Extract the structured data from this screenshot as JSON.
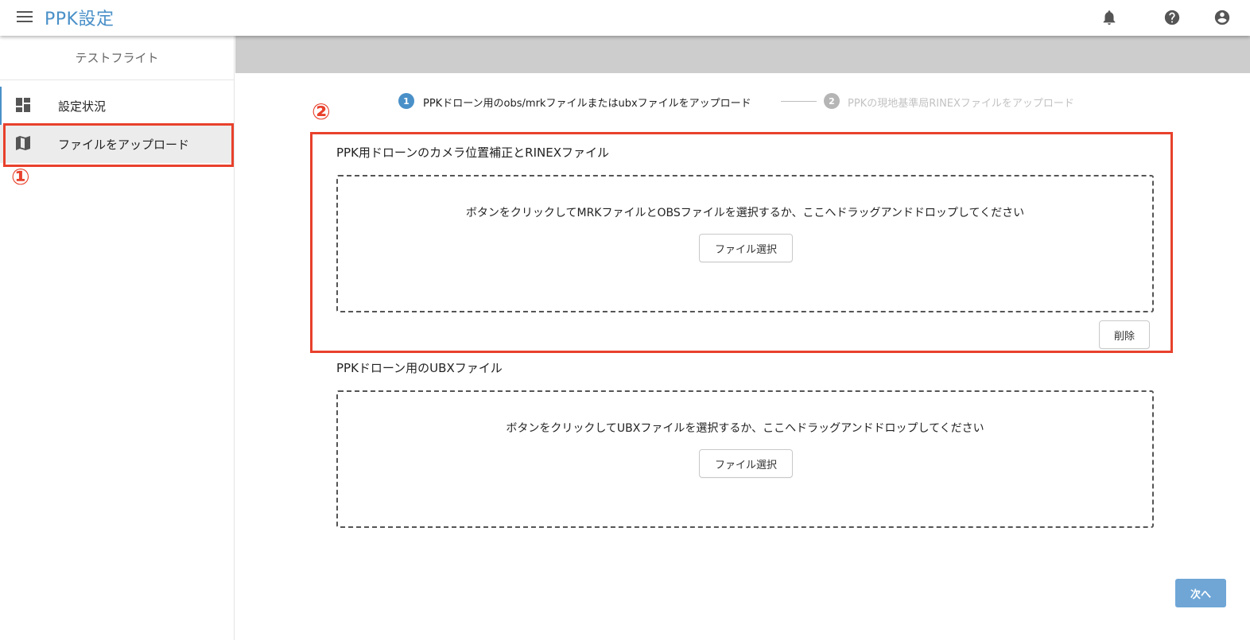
{
  "app": {
    "title": "PPK設定"
  },
  "topbar": {
    "icons": [
      "bell-icon",
      "help-icon",
      "account-icon"
    ]
  },
  "sidebar": {
    "header": "テストフライト",
    "items": [
      {
        "label": "設定状況",
        "icon": "dashboard-icon"
      },
      {
        "label": "ファイルをアップロード",
        "icon": "map-icon",
        "selected": true
      }
    ]
  },
  "annotations": {
    "one": "①",
    "two": "②"
  },
  "stepper": {
    "steps": [
      {
        "number": "1",
        "label": "PPKドローン用のobs/mrkファイルまたはubxファイルをアップロード",
        "active": true
      },
      {
        "number": "2",
        "label": "PPKの現地基準局RINEXファイルをアップロード",
        "active": false
      }
    ]
  },
  "sections": [
    {
      "title": "PPK用ドローンのカメラ位置補正とRINEXファイル",
      "drop_text": "ボタンをクリックしてMRKファイルとOBSファイルを選択するか、ここへドラッグアンドドロップしてください",
      "select_label": "ファイル選択",
      "delete_label": "削除"
    },
    {
      "title": "PPKドローン用のUBXファイル",
      "drop_text": "ボタンをクリックしてUBXファイルを選択するか、ここへドラッグアンドドロップしてください",
      "select_label": "ファイル選択"
    }
  ],
  "footer": {
    "next_label": "次へ"
  },
  "colors": {
    "accent": "#4a90c8",
    "annotation": "#e8412c",
    "primary_button": "#6fa6d6"
  }
}
